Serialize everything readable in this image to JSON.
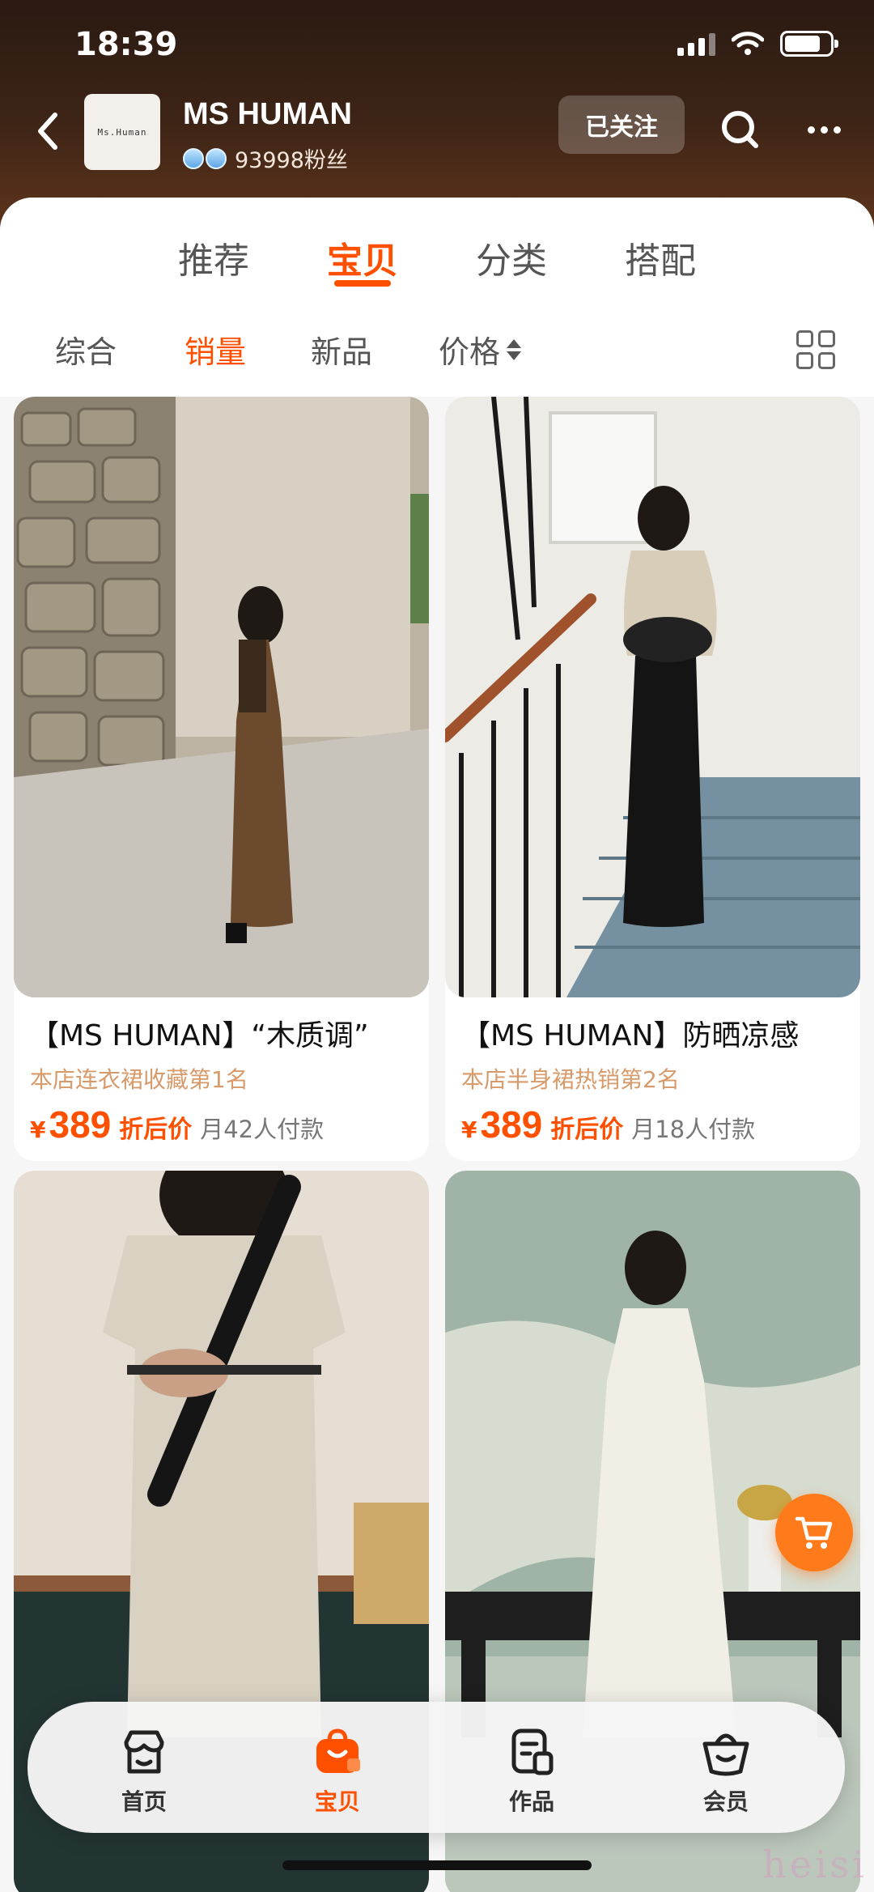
{
  "status_bar": {
    "time": "18:39"
  },
  "shop": {
    "logo_text": "Ms.Human",
    "name": "MS HUMAN",
    "fans": "93998粉丝",
    "follow_label": "已关注"
  },
  "top_tabs": [
    {
      "label": "推荐",
      "active": false
    },
    {
      "label": "宝贝",
      "active": true
    },
    {
      "label": "分类",
      "active": false
    },
    {
      "label": "搭配",
      "active": false
    }
  ],
  "sort_bar": {
    "items": [
      {
        "label": "综合",
        "active": false
      },
      {
        "label": "销量",
        "active": true
      },
      {
        "label": "新品",
        "active": false
      },
      {
        "label": "价格",
        "active": false
      }
    ]
  },
  "products": [
    {
      "title": "【MS HUMAN】“木质调”",
      "rank": "本店连衣裙收藏第1名",
      "currency": "¥",
      "price": "389",
      "discount_label": "折后价",
      "sold": "月42人付款"
    },
    {
      "title": "【MS HUMAN】防晒凉感",
      "rank": "本店半身裙热销第2名",
      "currency": "¥",
      "price": "389",
      "discount_label": "折后价",
      "sold": "月18人付款"
    },
    {
      "title": "",
      "rank": "",
      "currency": "",
      "price": "",
      "discount_label": "",
      "sold": ""
    },
    {
      "title": "",
      "rank": "",
      "currency": "",
      "price": "",
      "discount_label": "",
      "sold": ""
    }
  ],
  "bottom_nav": [
    {
      "label": "首页",
      "icon": "shop-icon",
      "active": false
    },
    {
      "label": "宝贝",
      "icon": "bag-icon",
      "active": true
    },
    {
      "label": "作品",
      "icon": "works-icon",
      "active": false
    },
    {
      "label": "会员",
      "icon": "member-basket-icon",
      "active": false
    }
  ],
  "watermark": "heisi",
  "colors": {
    "accent": "#ff5000",
    "rank_text": "#d79a6a",
    "header_dark": "#2a1a12"
  }
}
